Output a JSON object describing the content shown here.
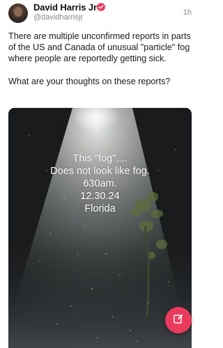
{
  "post": {
    "author_name": "David Harris Jr",
    "author_handle": "@davidharrisjr",
    "time": "1h",
    "paragraphs": [
      "There are multiple unconfirmed reports in parts of the US and Canada of unusual \"particle\" fog where people are reportedly getting sick.",
      "What are your thoughts on these reports?"
    ]
  },
  "media": {
    "caption_lines": [
      "This \"fog\"....",
      "Does not look like fog.",
      "630am.",
      "12.30.24",
      "Florida"
    ]
  },
  "colors": {
    "accent": "#ea3a5d",
    "verified": "#e8365d"
  },
  "icons": {
    "verified": "verified-badge-icon",
    "compose": "edit-icon"
  }
}
